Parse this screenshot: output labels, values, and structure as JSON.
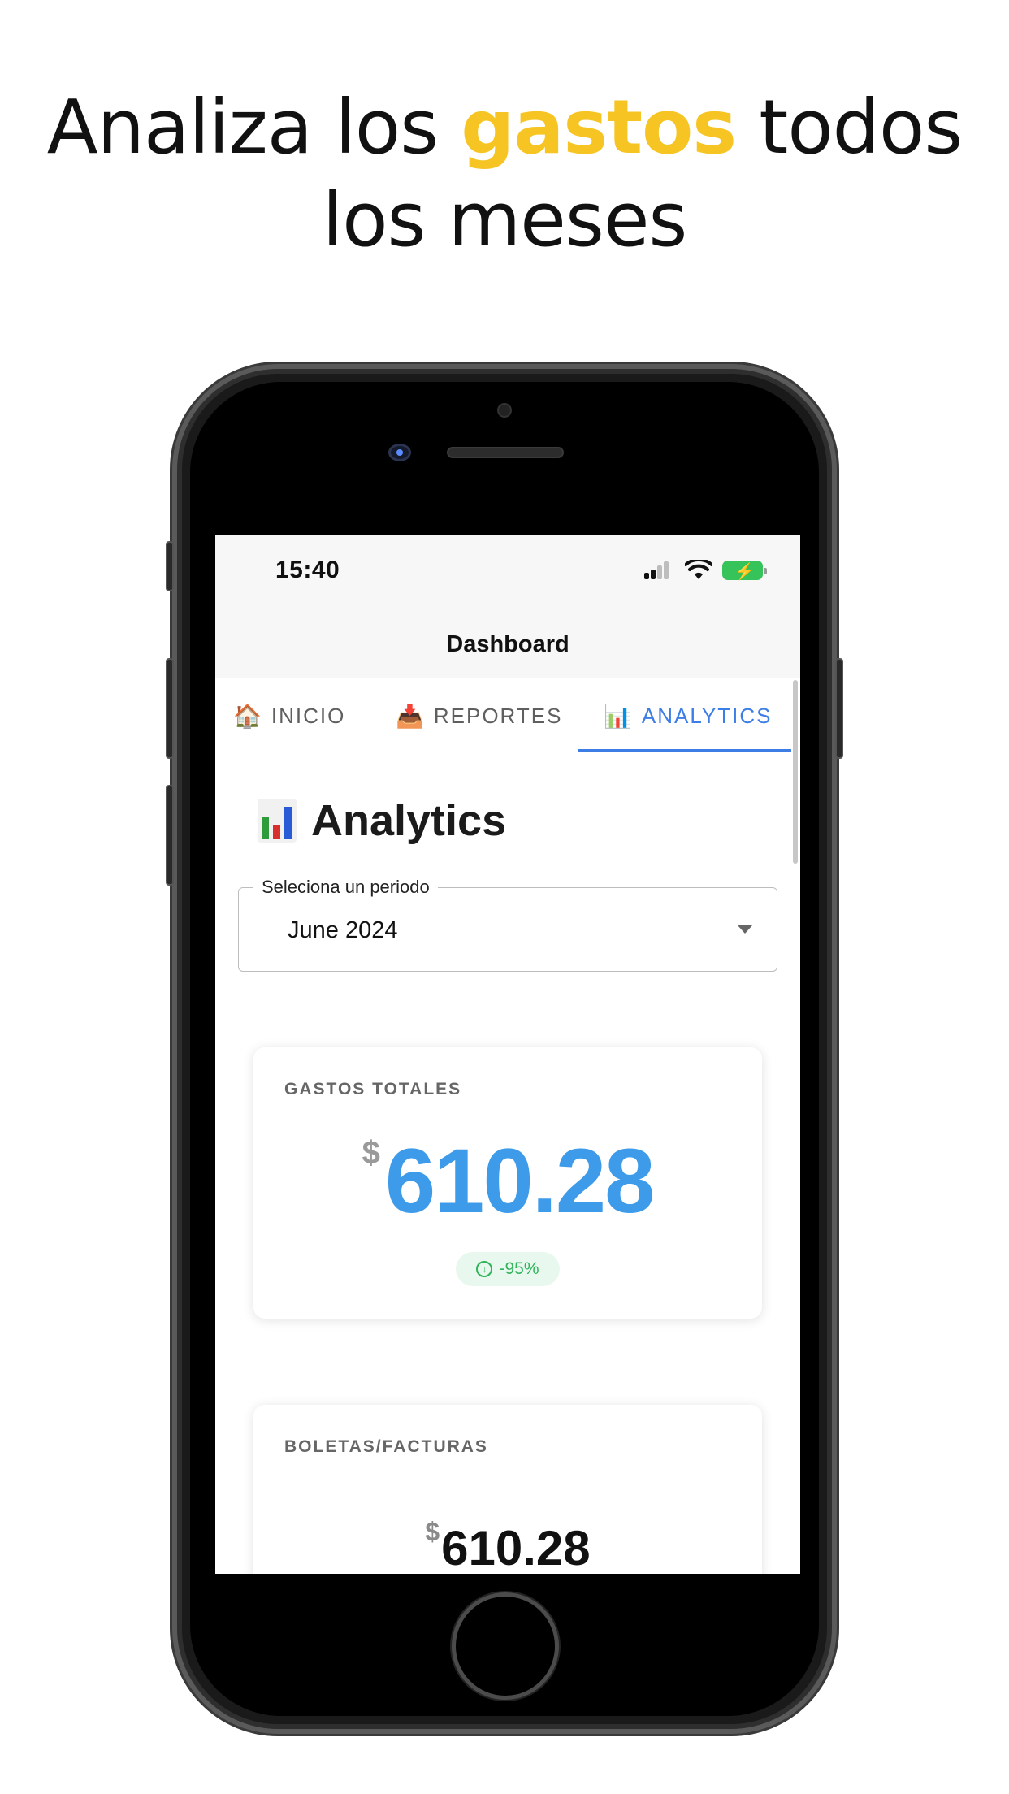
{
  "headline": {
    "part1": "Analiza los ",
    "highlight": "gastos",
    "part2": " todos",
    "line2": "los meses",
    "highlight_color": "#f6c523"
  },
  "status_bar": {
    "time": "15:40",
    "icons": [
      "cellular-signal-icon",
      "wifi-icon",
      "battery-charging-icon"
    ]
  },
  "nav": {
    "title": "Dashboard"
  },
  "tabs": [
    {
      "icon": "🏠",
      "label": "INICIO",
      "active": false
    },
    {
      "icon": "📥",
      "label": "REPORTES",
      "active": false
    },
    {
      "icon": "📊",
      "label": "ANALYTICS",
      "active": true
    }
  ],
  "page": {
    "title": "Analytics",
    "title_icon": "bar-chart-icon"
  },
  "period_select": {
    "label": "Seleciona un periodo",
    "value": "June 2024"
  },
  "cards": {
    "gastos_totales": {
      "label": "GASTOS TOTALES",
      "currency": "$",
      "amount": "610.28",
      "change": "-95%",
      "change_icon": "arrow-down-circle-icon"
    },
    "boletas_facturas": {
      "label": "BOLETAS/FACTURAS",
      "currency": "$",
      "amount": "610.28"
    }
  },
  "colors": {
    "accent": "#3d7ee6",
    "amount_blue": "#3d9be9",
    "badge_green": "#2fb45a"
  }
}
